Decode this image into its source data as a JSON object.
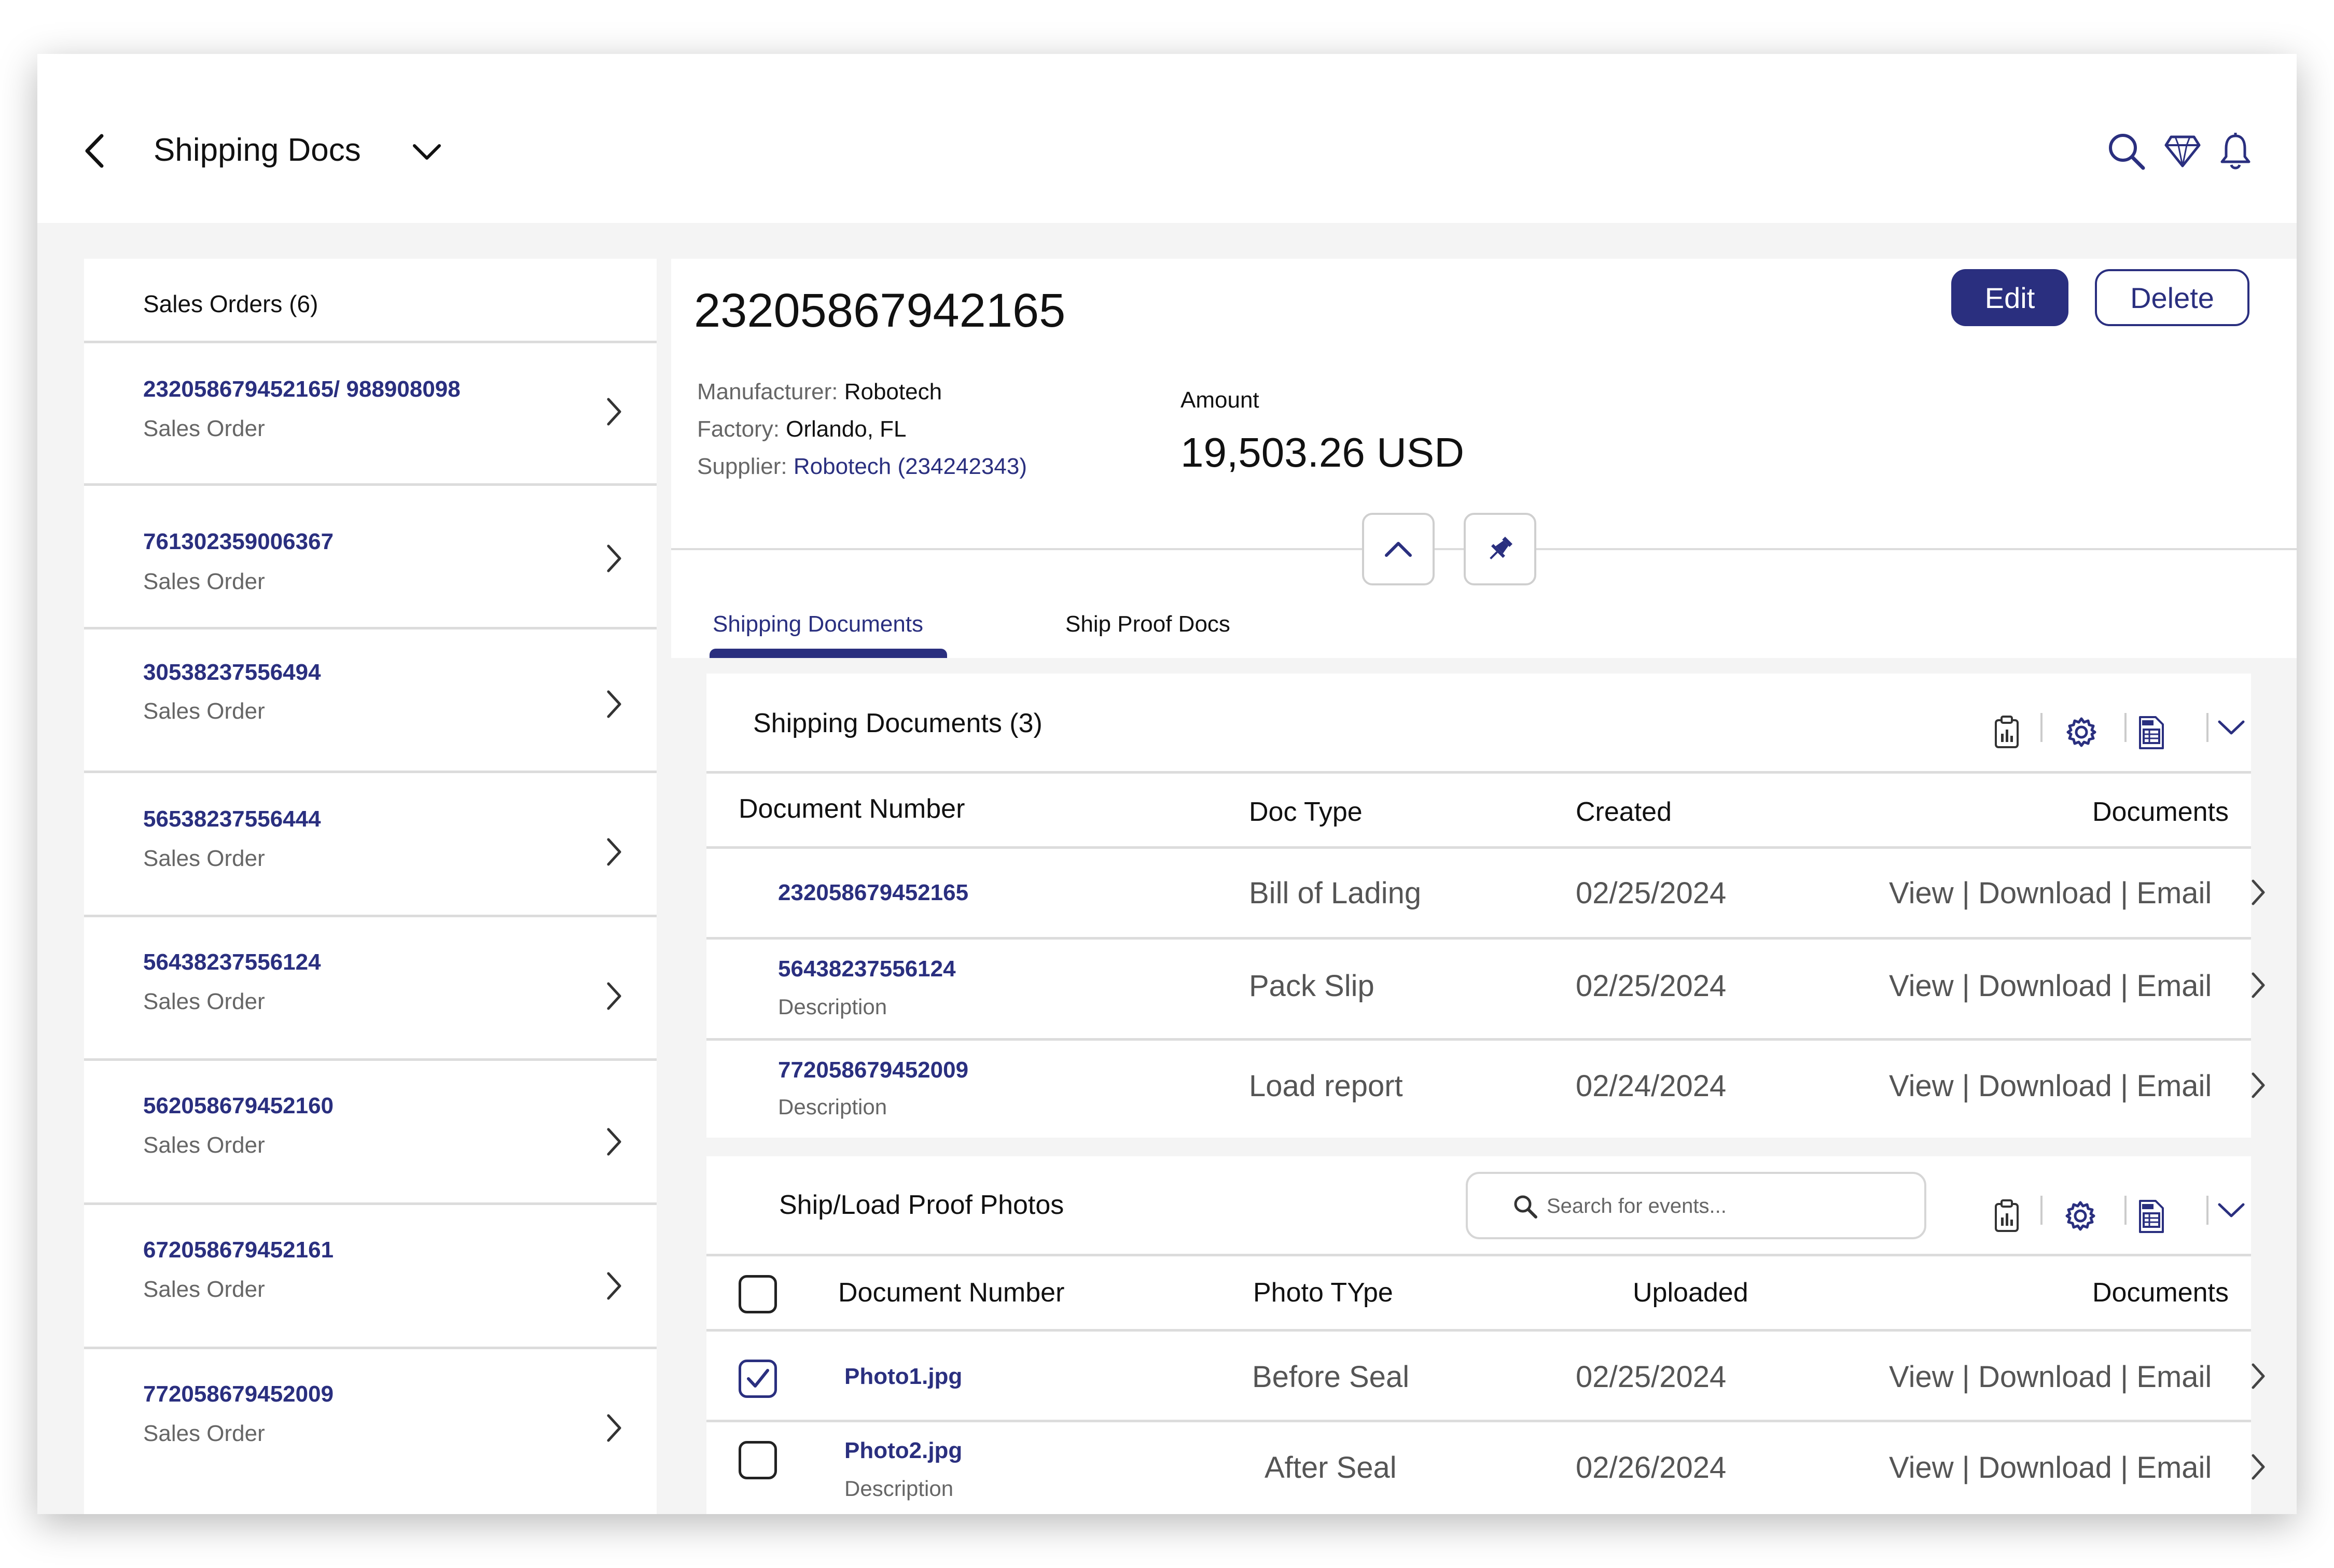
{
  "header": {
    "title": "Shipping Docs"
  },
  "sales_orders": {
    "heading": "Sales Orders (6)",
    "items": [
      {
        "number": "232058679452165/ 988908098",
        "type": "Sales Order"
      },
      {
        "number": "761302359006367",
        "type": "Sales Order"
      },
      {
        "number": "30538237556494",
        "type": "Sales Order"
      },
      {
        "number": "56538237556444",
        "type": "Sales Order"
      },
      {
        "number": "56438237556124",
        "type": "Sales Order"
      },
      {
        "number": "562058679452160",
        "type": "Sales Order"
      },
      {
        "number": "672058679452161",
        "type": "Sales Order"
      },
      {
        "number": "772058679452009",
        "type": "Sales Order"
      }
    ]
  },
  "detail": {
    "order_number": "23205867942165",
    "edit_label": "Edit",
    "delete_label": "Delete",
    "manufacturer_label": "Manufacturer:",
    "manufacturer_value": "Robotech",
    "factory_label": "Factory:",
    "factory_value": "Orlando, FL",
    "supplier_label": "Supplier:",
    "supplier_value": "Robotech (234242343)",
    "amount_label": "Amount",
    "amount_value": "19,503.26 USD"
  },
  "tabs": [
    {
      "label": "Shipping Documents",
      "active": true
    },
    {
      "label": "Ship Proof Docs",
      "active": false
    }
  ],
  "shipping_documents": {
    "title": "Shipping Documents (3)",
    "columns": [
      "Document Number",
      "Doc Type",
      "Created",
      "Documents"
    ],
    "rows": [
      {
        "number": "232058679452165",
        "description": "",
        "doc_type": "Bill of Lading",
        "created": "02/25/2024"
      },
      {
        "number": "56438237556124",
        "description": "Description",
        "doc_type": "Pack Slip",
        "created": "02/25/2024"
      },
      {
        "number": "772058679452009",
        "description": "Description",
        "doc_type": "Load report",
        "created": "02/24/2024"
      }
    ]
  },
  "proof_photos": {
    "title": "Ship/Load Proof Photos",
    "search_placeholder": "Search for events...",
    "columns": [
      "Document Number",
      "Photo TYpe",
      "Uploaded",
      "Documents"
    ],
    "rows": [
      {
        "number": "Photo1.jpg",
        "description": "",
        "photo_type": "Before Seal",
        "uploaded": "02/25/2024",
        "checked": true
      },
      {
        "number": "Photo2.jpg",
        "description": "Description",
        "photo_type": "After Seal",
        "uploaded": "02/26/2024",
        "checked": false
      }
    ]
  },
  "actions": {
    "view": "View",
    "download": "Download",
    "email": "Email",
    "separator": "|"
  },
  "colors": {
    "accent": "#2a2f7f",
    "background": "#f4f4f4",
    "divider": "#dcdcdc",
    "muted_text": "#666666"
  },
  "icons": [
    "back-arrow-icon",
    "chevron-down-icon",
    "search-icon",
    "diamond-icon",
    "bell-icon",
    "chevron-right-icon",
    "chevron-up-icon",
    "pin-icon",
    "clipboard-icon",
    "gear-icon",
    "document-icon"
  ]
}
